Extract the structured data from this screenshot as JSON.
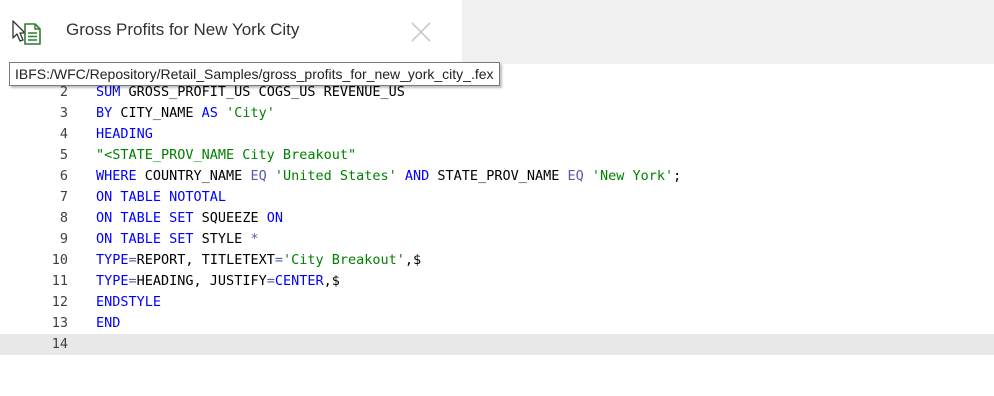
{
  "tab": {
    "title": "Gross Profits for New York City",
    "icon": "report-file-icon",
    "close_icon": "close-icon"
  },
  "tooltip": {
    "text": "IBFS:/WFC/Repository/Retail_Samples/gross_profits_for_new_york_city_.fex"
  },
  "colors": {
    "keyword": "#0000ff",
    "string": "#008000",
    "operator": "#5a5aa8",
    "text": "#000000",
    "current_line": "#e8e8e8"
  },
  "editor": {
    "lines": [
      {
        "num": "2",
        "partial": true,
        "tokens": [
          {
            "t": "SUM",
            "c": "kw"
          },
          {
            "t": " GROSS_PROFIT_US COGS_US REVENUE_US",
            "c": "plain"
          }
        ]
      },
      {
        "num": "3",
        "tokens": [
          {
            "t": "BY",
            "c": "kw"
          },
          {
            "t": " CITY_NAME ",
            "c": "plain"
          },
          {
            "t": "AS",
            "c": "kw"
          },
          {
            "t": " ",
            "c": "plain"
          },
          {
            "t": "'City'",
            "c": "str"
          }
        ]
      },
      {
        "num": "4",
        "tokens": [
          {
            "t": "HEADING",
            "c": "kw"
          }
        ]
      },
      {
        "num": "5",
        "tokens": [
          {
            "t": "\"<STATE_PROV_NAME City Breakout\"",
            "c": "str"
          }
        ]
      },
      {
        "num": "6",
        "tokens": [
          {
            "t": "WHERE",
            "c": "kw"
          },
          {
            "t": " COUNTRY_NAME ",
            "c": "plain"
          },
          {
            "t": "EQ",
            "c": "op"
          },
          {
            "t": " ",
            "c": "plain"
          },
          {
            "t": "'United States'",
            "c": "str"
          },
          {
            "t": " ",
            "c": "plain"
          },
          {
            "t": "AND",
            "c": "kw"
          },
          {
            "t": " STATE_PROV_NAME ",
            "c": "plain"
          },
          {
            "t": "EQ",
            "c": "op"
          },
          {
            "t": " ",
            "c": "plain"
          },
          {
            "t": "'New York'",
            "c": "str"
          },
          {
            "t": ";",
            "c": "plain"
          }
        ]
      },
      {
        "num": "7",
        "tokens": [
          {
            "t": "ON TABLE NOTOTAL",
            "c": "kw"
          }
        ]
      },
      {
        "num": "8",
        "tokens": [
          {
            "t": "ON TABLE SET",
            "c": "kw"
          },
          {
            "t": " SQUEEZE ",
            "c": "plain"
          },
          {
            "t": "ON",
            "c": "kw"
          }
        ]
      },
      {
        "num": "9",
        "tokens": [
          {
            "t": "ON TABLE SET",
            "c": "kw"
          },
          {
            "t": " STYLE ",
            "c": "plain"
          },
          {
            "t": "*",
            "c": "op"
          }
        ]
      },
      {
        "num": "10",
        "tokens": [
          {
            "t": "TYPE",
            "c": "kw"
          },
          {
            "t": "=",
            "c": "op"
          },
          {
            "t": "REPORT, ",
            "c": "plain"
          },
          {
            "t": "TITLETEXT",
            "c": "plain"
          },
          {
            "t": "=",
            "c": "op"
          },
          {
            "t": "'City Breakout'",
            "c": "str"
          },
          {
            "t": ",$",
            "c": "plain"
          }
        ]
      },
      {
        "num": "11",
        "tokens": [
          {
            "t": "TYPE",
            "c": "kw"
          },
          {
            "t": "=",
            "c": "op"
          },
          {
            "t": "HEADING, JUSTIFY",
            "c": "plain"
          },
          {
            "t": "=",
            "c": "op"
          },
          {
            "t": "CENTER",
            "c": "kw"
          },
          {
            "t": ",$",
            "c": "plain"
          }
        ]
      },
      {
        "num": "12",
        "tokens": [
          {
            "t": "ENDSTYLE",
            "c": "kw"
          }
        ]
      },
      {
        "num": "13",
        "tokens": [
          {
            "t": "END",
            "c": "kw"
          }
        ]
      },
      {
        "num": "14",
        "current": true,
        "tokens": []
      }
    ]
  }
}
